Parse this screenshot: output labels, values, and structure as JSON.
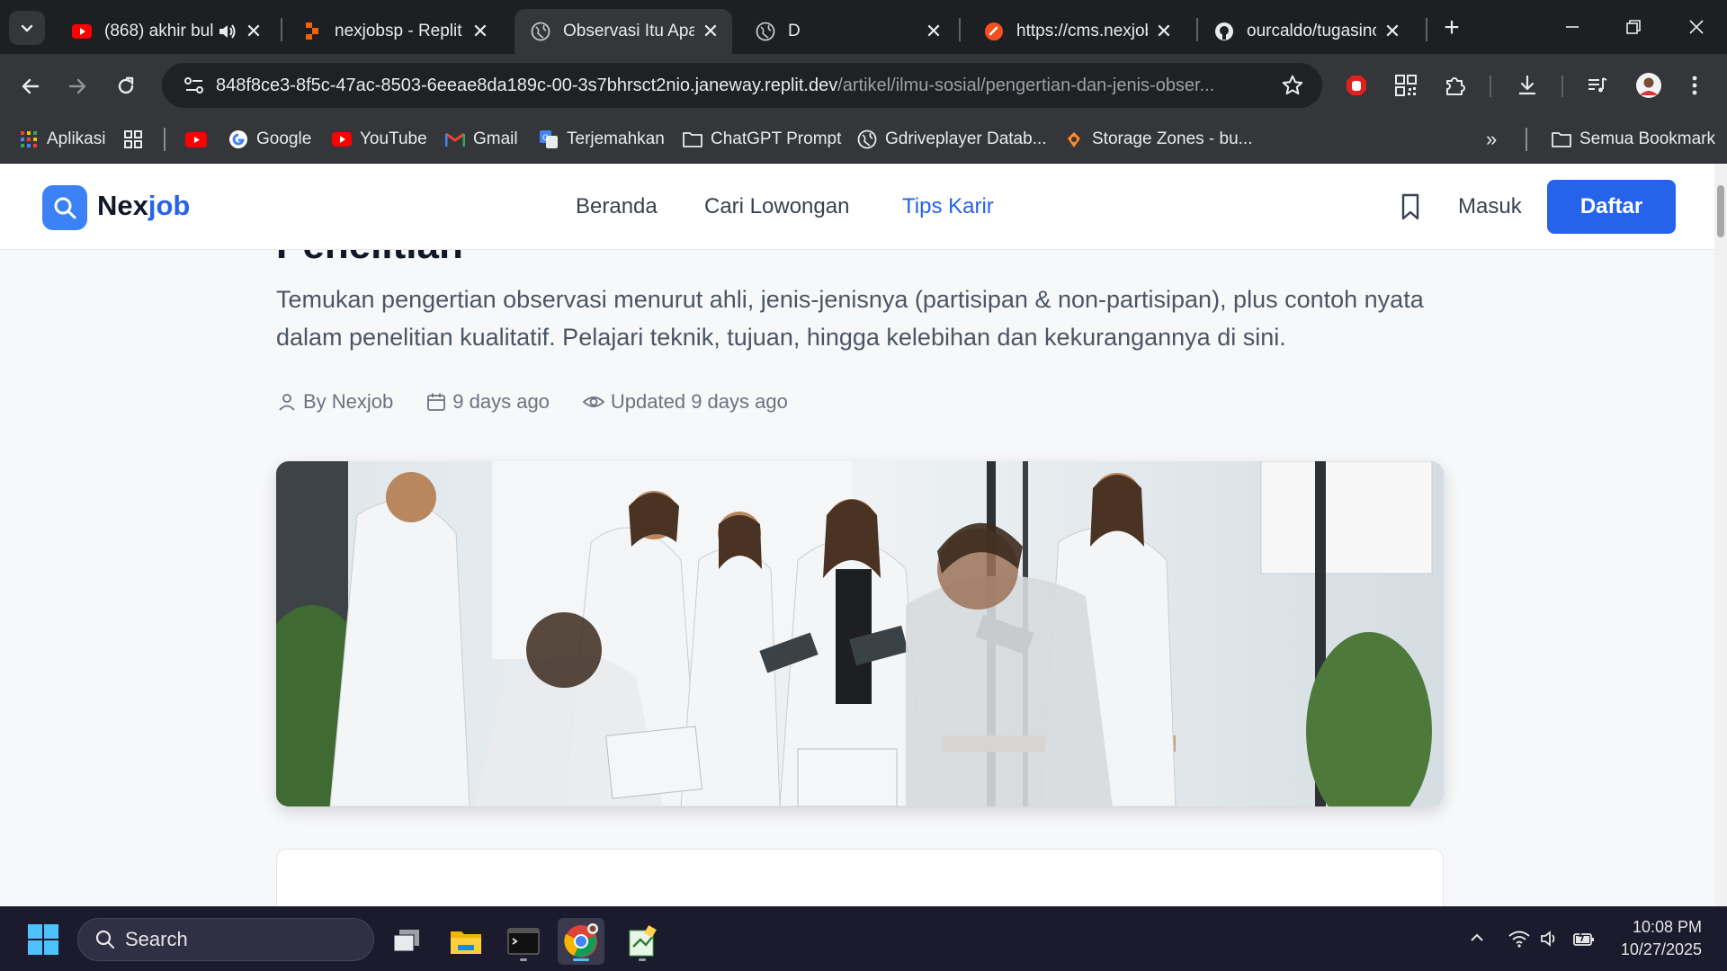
{
  "browser": {
    "tabs": [
      {
        "title": "(868) akhir bul",
        "favicon": "youtube-icon",
        "audio": true
      },
      {
        "title": "nexjobsp - Replit",
        "favicon": "replit-icon"
      },
      {
        "title": "Observasi Itu Apa?",
        "favicon": "globe-icon",
        "active": true
      },
      {
        "title": "D",
        "favicon": "globe-icon"
      },
      {
        "title": "https://cms.nexjob",
        "favicon": "site-icon"
      },
      {
        "title": "ourcaldo/tugasinc",
        "favicon": "github-icon"
      }
    ],
    "url_host": "848f8ce3-8f5c-47ac-8503-6eeae8da189c-00-3s7bhrsct2nio.janeway.replit.dev",
    "url_path": "/artikel/ilmu-sosial/pengertian-dan-jenis-obser...",
    "bookmarks": [
      {
        "label": "Aplikasi",
        "icon": "apps-grid-icon"
      },
      {
        "label": "",
        "icon": "grid-icon"
      },
      {
        "label": "",
        "icon": "youtube-icon"
      },
      {
        "label": "Google",
        "icon": "google-icon"
      },
      {
        "label": "YouTube",
        "icon": "youtube-icon"
      },
      {
        "label": "Gmail",
        "icon": "gmail-icon"
      },
      {
        "label": "Terjemahkan",
        "icon": "translate-icon"
      },
      {
        "label": "ChatGPT Prompt",
        "icon": "folder-icon"
      },
      {
        "label": "Gdriveplayer Datab...",
        "icon": "globe-icon"
      },
      {
        "label": "Storage Zones - bu...",
        "icon": "bunny-icon"
      }
    ],
    "all_bookmarks": "Semua Bookmark"
  },
  "site": {
    "logo_main": "Nex",
    "logo_accent": "job",
    "nav": [
      "Beranda",
      "Cari Lowongan",
      "Tips Karir"
    ],
    "login": "Masuk",
    "register": "Daftar",
    "colors": {
      "accent": "#2563eb",
      "logo_bg": "#3b82f6"
    }
  },
  "article": {
    "title_fragment": "Penelitian",
    "lead": "Temukan pengertian observasi menurut ahli, jenis-jenisnya (partisipan & non-partisipan), plus contoh nyata dalam penelitian kualitatif. Pelajari teknik, tujuan, hingga kelebihan dan kekurangannya di sini.",
    "author": "By Nexjob",
    "published": "9 days ago",
    "updated": "Updated 9 days ago",
    "hero_alt": "team of professionals in white coats with tablets"
  },
  "taskbar": {
    "search_label": "Search",
    "time": "10:08 PM",
    "date": "10/27/2025"
  }
}
